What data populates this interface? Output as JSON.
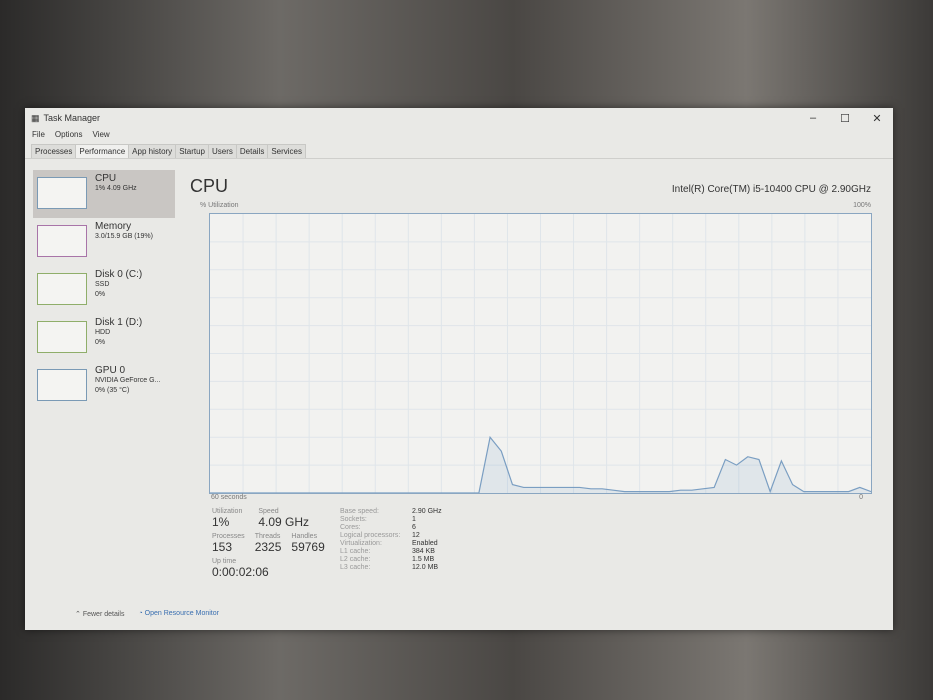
{
  "window": {
    "title": "Task Manager",
    "menu": [
      "File",
      "Options",
      "View"
    ],
    "tabs": [
      "Processes",
      "Performance",
      "App history",
      "Startup",
      "Users",
      "Details",
      "Services"
    ],
    "active_tab": "Performance"
  },
  "sidebar": [
    {
      "name": "CPU",
      "line1": "1% 4.09 GHz",
      "line2": ""
    },
    {
      "name": "Memory",
      "line1": "3.0/15.9 GB (19%)",
      "line2": ""
    },
    {
      "name": "Disk 0 (C:)",
      "line1": "SSD",
      "line2": "0%"
    },
    {
      "name": "Disk 1 (D:)",
      "line1": "HDD",
      "line2": "0%"
    },
    {
      "name": "GPU 0",
      "line1": "NVIDIA GeForce G...",
      "line2": "0% (35 °C)"
    }
  ],
  "main": {
    "title": "CPU",
    "cpu_model": "Intel(R) Core(TM) i5-10400 CPU @ 2.90GHz",
    "util_label": "% Utilization",
    "max_label": "100%",
    "time_label": "60 seconds",
    "min_label": "0",
    "stats": {
      "utilization_label": "Utilization",
      "utilization": "1%",
      "speed_label": "Speed",
      "speed": "4.09 GHz",
      "processes_label": "Processes",
      "processes": "153",
      "threads_label": "Threads",
      "threads": "2325",
      "handles_label": "Handles",
      "handles": "59769",
      "uptime_label": "Up time",
      "uptime": "0:00:02:06"
    },
    "specs": [
      [
        "Base speed:",
        "2.90 GHz"
      ],
      [
        "Sockets:",
        "1"
      ],
      [
        "Cores:",
        "6"
      ],
      [
        "Logical processors:",
        "12"
      ],
      [
        "Virtualization:",
        "Enabled"
      ],
      [
        "L1 cache:",
        "384 KB"
      ],
      [
        "L2 cache:",
        "1.5 MB"
      ],
      [
        "L3 cache:",
        "12.0 MB"
      ]
    ]
  },
  "footer": {
    "fewer_details": "Fewer details",
    "open_monitor": "Open Resource Monitor"
  },
  "chart_data": {
    "type": "line",
    "title": "% Utilization",
    "xlabel": "60 seconds",
    "ylim": [
      0,
      100
    ],
    "grid": true,
    "values": [
      0,
      0,
      0,
      0,
      0,
      0,
      0,
      0,
      0,
      0,
      0,
      0,
      0,
      0,
      0,
      0,
      0,
      0,
      0,
      0,
      0,
      0,
      0,
      0,
      0,
      20,
      15,
      3,
      2,
      2,
      2,
      2,
      2,
      2,
      1.5,
      1.5,
      1,
      0.5,
      0.5,
      0.5,
      0.5,
      0.5,
      1,
      1,
      1.5,
      2,
      12,
      10,
      13,
      12,
      0.5,
      11.5,
      3,
      0.5,
      0.5,
      0.5,
      0.5,
      0.5,
      2,
      0.5
    ]
  }
}
